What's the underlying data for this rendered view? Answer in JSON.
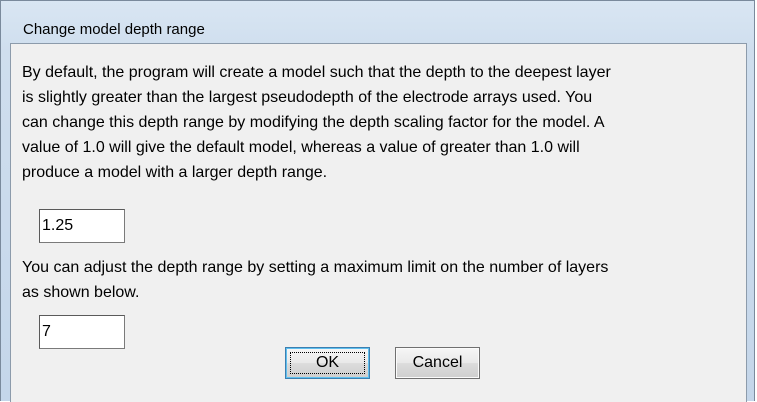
{
  "window": {
    "title": "Change model depth range"
  },
  "depth_section": {
    "description_lines": [
      "By default, the program will create a model such that the depth to the deepest layer",
      "is slightly greater than the largest pseudodepth of the electrode arrays used. You",
      "can change this depth range by modifying the depth scaling factor for the model. A",
      "value of 1.0 will give the default model, whereas a value of greater than 1.0 will",
      "produce a model with a larger depth range."
    ],
    "scaling_factor_value": "1.25"
  },
  "layers_section": {
    "description_lines": [
      "You can adjust the depth range by setting a maximum limit on the number of layers",
      "as shown below."
    ],
    "max_layers_value": "7"
  },
  "buttons": {
    "ok_label": "OK",
    "cancel_label": "Cancel"
  }
}
